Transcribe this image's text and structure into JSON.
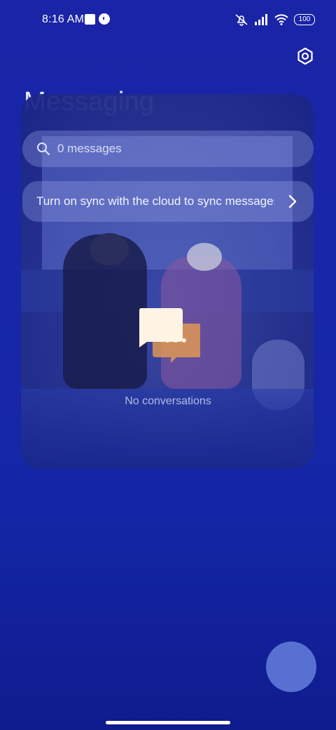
{
  "status_bar": {
    "time": "8:16 AM",
    "battery": "100",
    "icons": [
      "app-notification-icon",
      "profile-notification-icon",
      "mute-icon",
      "signal-icon",
      "wifi-icon",
      "battery-icon"
    ]
  },
  "header": {
    "title": "Messaging",
    "settings_icon": "gear-icon"
  },
  "search": {
    "placeholder": "0 messages",
    "icon": "search-icon"
  },
  "sync_banner": {
    "text": "Turn on sync with the cloud to sync messages",
    "icon": "chevron-right-icon"
  },
  "empty_state": {
    "text": "No conversations",
    "icon": "chat-bubbles-icon"
  },
  "fab": {
    "icon": "compose-icon"
  },
  "colors": {
    "background": "#1a24a6",
    "fab": "#5870d2",
    "card": "#2a3690",
    "bubble_primary": "#fff3e3",
    "bubble_secondary": "#f0a24a"
  }
}
